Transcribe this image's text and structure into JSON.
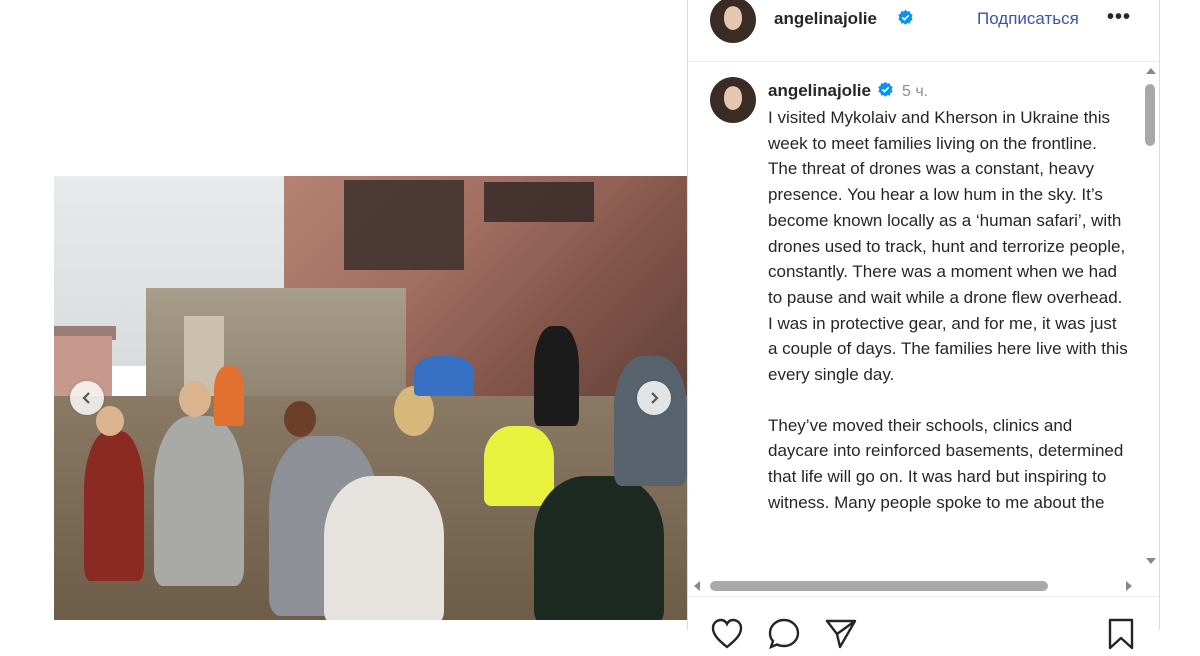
{
  "post": {
    "author": "angelinajolie",
    "follow_label": "Подписаться",
    "more_label": "•••",
    "time": "5 ч.",
    "caption_paragraphs": [
      "I visited Mykolaiv and Kherson in Ukraine this week to meet families living on the frontline. The threat of drones was a constant, heavy presence. You hear a low hum in the sky. It’s become known locally as a ‘human safari’, with drones used to track, hunt and terrorize people, constantly. There was a moment when we had to pause and wait while a drone flew overhead. I was in protective gear, and for me, it was just a couple of days. The families here live with this every single day.",
      "They’ve moved their schools, clinics and daycare into reinforced basements, determined that life will go on. It was hard but inspiring to witness. Many people spoke to me about the"
    ]
  },
  "icons": {
    "verified": "verified-badge-icon",
    "prev": "chevron-left-icon",
    "next": "chevron-right-icon",
    "like": "heart-icon",
    "comment": "comment-bubble-icon",
    "share": "paper-plane-icon",
    "save": "bookmark-icon"
  },
  "colors": {
    "verified": "#0095f6",
    "follow": "#3a55a6",
    "text": "#262626",
    "muted": "#8e8e8e"
  }
}
